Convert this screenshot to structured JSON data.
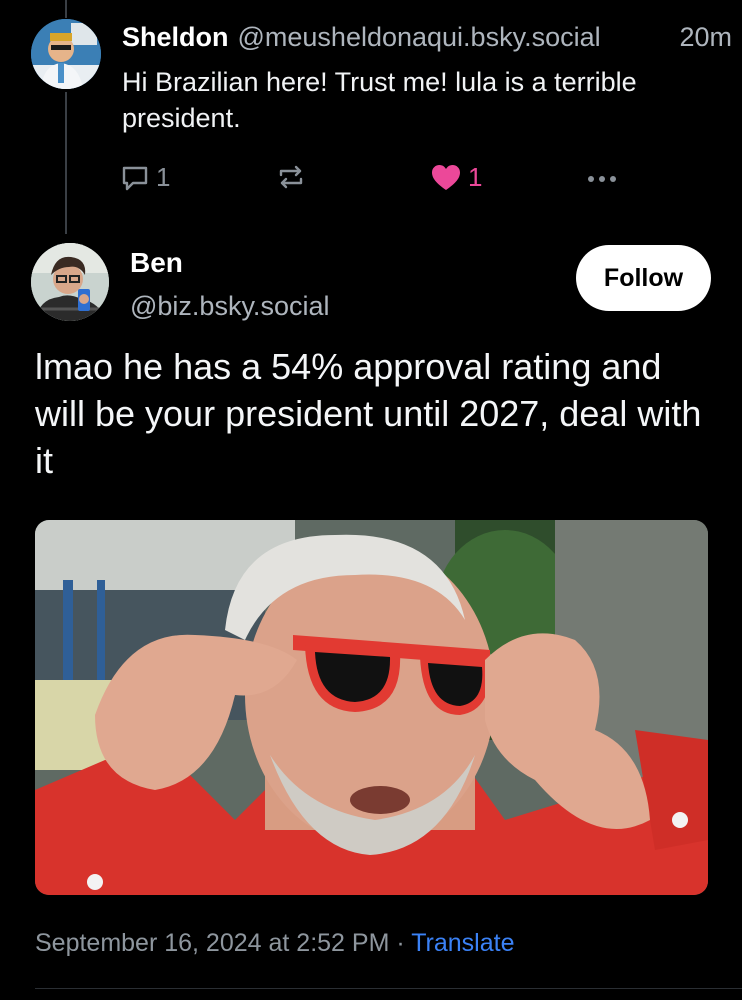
{
  "parent_post": {
    "author_name": "Sheldon",
    "author_handle": "@meusheldonaqui.bsky.social",
    "time_ago": "20m",
    "text": "Hi Brazilian here! Trust me! lula is a terrible president.",
    "reply_count": "1",
    "like_count": "1",
    "liked": true
  },
  "main_post": {
    "author_name": "Ben",
    "author_handle": "@biz.bsky.social",
    "follow_label": "Follow",
    "text": "lmao he has a 54% approval rating and will be your president until 2027, deal with it",
    "timestamp": "September 16, 2024 at 2:52 PM",
    "separator": "·",
    "translate_label": "Translate"
  },
  "colors": {
    "background": "#000000",
    "like": "#ec4899",
    "link": "#3b82f6",
    "muted": "#8e969e"
  },
  "icons": [
    "reply-icon",
    "repost-icon",
    "heart-icon",
    "more-icon"
  ]
}
